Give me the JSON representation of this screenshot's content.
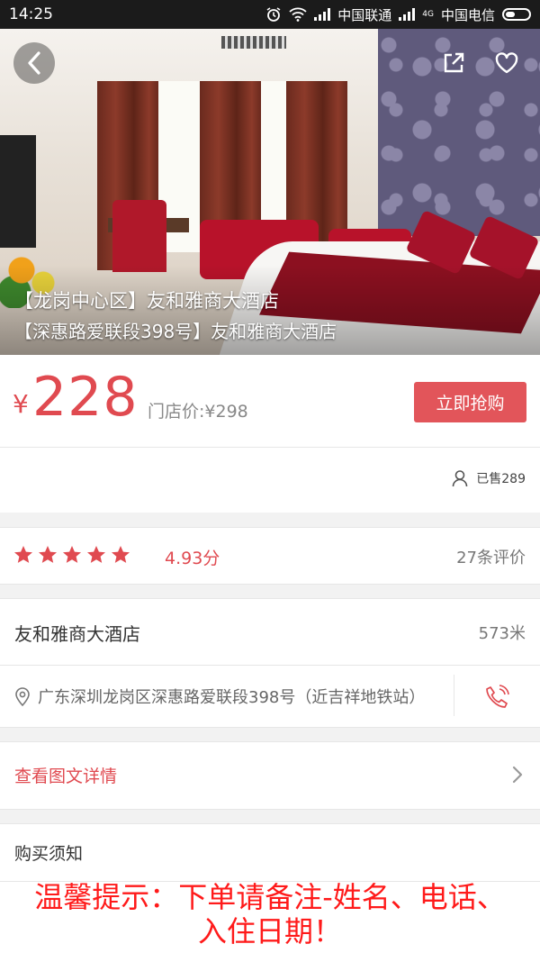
{
  "status_bar": {
    "time": "14:25",
    "carrier1": "中国联通",
    "network_small": "4G",
    "carrier2": "中国电信"
  },
  "hero": {
    "title_line1": "【龙岗中心区】友和雅商大酒店",
    "title_line2": "【深惠路爱联段398号】友和雅商大酒店"
  },
  "price": {
    "currency": "¥",
    "amount": "228",
    "store_price": "门店价:¥298",
    "buy_label": "立即抢购",
    "sold": "已售289"
  },
  "rating": {
    "stars": 5,
    "score": "4.93分",
    "reviews": "27条评价"
  },
  "hotel": {
    "name": "友和雅商大酒店",
    "distance": "573米",
    "address": "广东深圳龙岗区深惠路爱联段398号（近吉祥地铁站）"
  },
  "detail": {
    "link_label": "查看图文详情"
  },
  "notice": {
    "title": "购买须知",
    "text": "温馨提示：下单请备注-姓名、电话、入住日期！"
  },
  "colors": {
    "accent": "#e04a50",
    "button": "#e2555a",
    "notice_text": "#ff1a1a"
  }
}
